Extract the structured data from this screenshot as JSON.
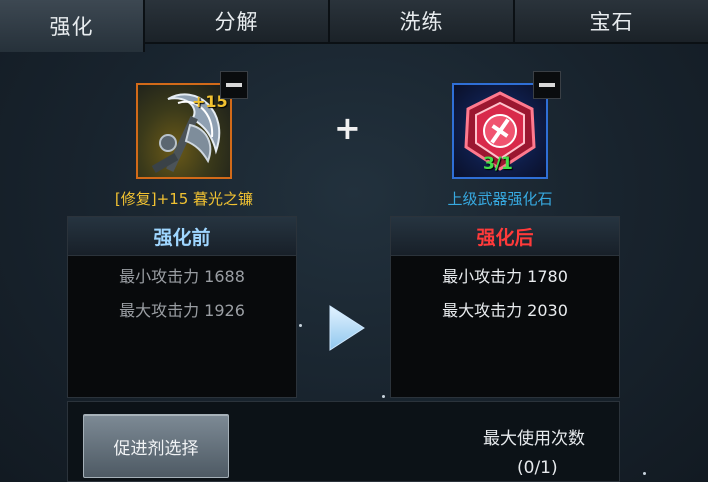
{
  "tabs": [
    {
      "label": "强化",
      "active": true
    },
    {
      "label": "分解",
      "active": false
    },
    {
      "label": "洗练",
      "active": false
    },
    {
      "label": "宝石",
      "active": false
    }
  ],
  "equipment": {
    "level": "+15",
    "name": "[修复]+15 暮光之镰",
    "icon": "scythe-icon",
    "border_color": "#d26a19"
  },
  "material": {
    "count": "3/1",
    "name": "上级武器强化石",
    "icon": "red-gem-icon",
    "border_color": "#2f6fd6"
  },
  "plus_symbol": "+",
  "before": {
    "title": "强化前",
    "stats": [
      "最小攻击力 1688",
      "最大攻击力 1926"
    ]
  },
  "after": {
    "title": "强化后",
    "stats": [
      "最小攻击力 1780",
      "最大攻击力 2030"
    ]
  },
  "promoter_button": "促进剂选择",
  "max_uses_label": "最大使用次数",
  "max_uses_value": "(0/1)",
  "colors": {
    "gold_text": "#f1c232",
    "material_text": "#37a9e0",
    "after_title": "#ff3a3a",
    "before_title": "#9fd6ff",
    "count_text": "#44e04a"
  }
}
